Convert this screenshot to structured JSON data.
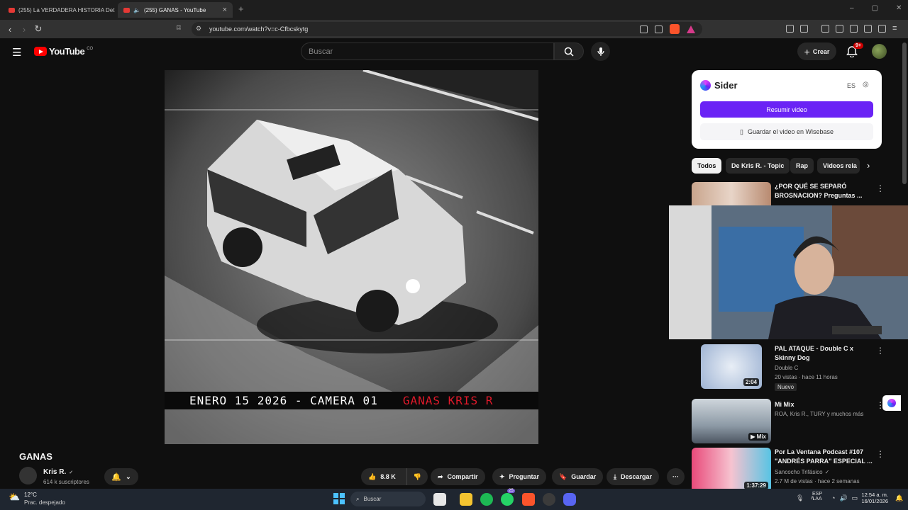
{
  "browser": {
    "tabs": [
      {
        "label": "(255) La VERDADERA HISTORIA Detrá"
      },
      {
        "label": "(255) GANAS - YouTube"
      }
    ],
    "url": "youtube.com/watch?v=c-Cfbcskytg"
  },
  "youtube": {
    "logo_text": "YouTube",
    "logo_sup": "CO",
    "search_placeholder": "Buscar",
    "create_label": "Crear",
    "notif_count": "9+"
  },
  "video": {
    "caption_left": "ENERO 15 2026 - CAMERA 01",
    "caption_right": "GANAS KRIS R",
    "title": "GANAS",
    "channel": "Kris R.",
    "subscribers": "614 k suscriptores",
    "likes": "8.8 K",
    "share": "Compartir",
    "ask": "Preguntar",
    "save": "Guardar",
    "download": "Descargar"
  },
  "sider": {
    "name": "Sider",
    "lang": "ES",
    "summarize": "Resumir video",
    "save_wisebase": "Guardar el video en Wisebase"
  },
  "chips": [
    "Todos",
    "De Kris R. - Topic",
    "Rap",
    "Videos rela"
  ],
  "recommendations": [
    {
      "title": "¿POR QUÉ SE SEPARÓ BROSNACION? Preguntas ...",
      "channel": "",
      "meta": "",
      "badge": "",
      "tag": ""
    },
    {
      "title": "PAL ATAQUE - Double C x Skinny Dog",
      "channel": "Double C",
      "meta": "20 vistas · hace 11 horas",
      "badge": "2:04",
      "tag": "Nuevo"
    },
    {
      "title": "Mi Mix",
      "channel": "ROA, Kris R., TURY y muchos más",
      "meta": "",
      "badge": "Mix",
      "tag": ""
    },
    {
      "title": "Por La Ventana Podcast #107 \"ANDRÉS PARRA\" ESPECIAL ...",
      "channel": "Sancocho Trifásico",
      "meta": "2.7 M de vistas · hace 2 semanas",
      "badge": "1:37:29",
      "tag": ""
    }
  ],
  "taskbar": {
    "weather_temp": "12°C",
    "weather_desc": "Prac. despejado",
    "search": "Buscar",
    "lang": "ESP",
    "lang2": "LAA",
    "time": "12:54 a. m.",
    "date": "16/01/2026",
    "whatsapp_badge": "25"
  },
  "colors": {
    "accent": "#6a23f5",
    "yt_red": "#ff0000",
    "caption_red": "#e0192a"
  }
}
